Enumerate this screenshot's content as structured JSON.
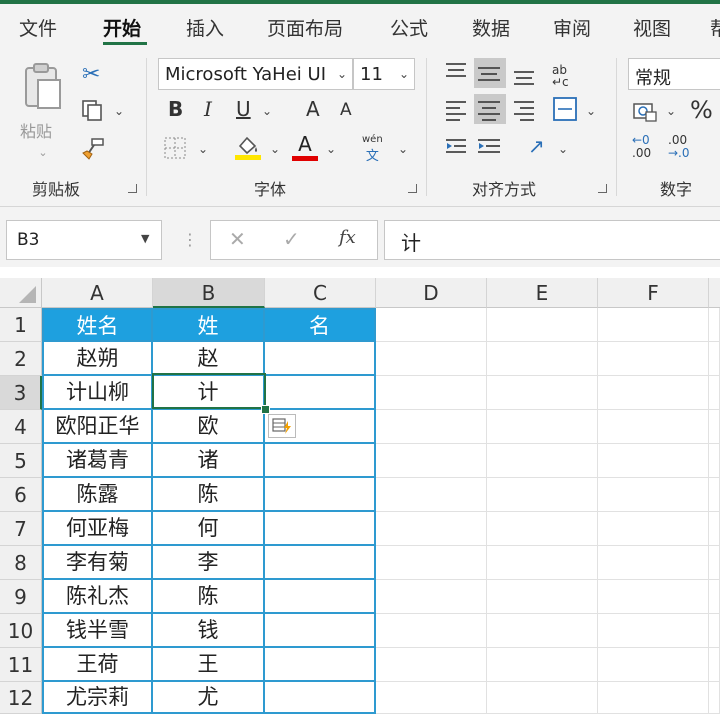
{
  "tabs": [
    "文件",
    "开始",
    "插入",
    "页面布局",
    "公式",
    "数据",
    "审阅",
    "视图",
    "帮"
  ],
  "ribbon": {
    "clipboard": {
      "paste_label": "粘贴",
      "group_label": "剪贴板"
    },
    "font": {
      "font_name": "Microsoft YaHei UI",
      "font_size": "11",
      "bold": "B",
      "italic": "I",
      "underline": "U",
      "grow": "A",
      "shrink": "A",
      "color": "A",
      "phonetic_top": "wén",
      "phonetic_bottom": "文",
      "group_label": "字体",
      "fill_color": "#ffe600",
      "font_color": "#e00000"
    },
    "alignment": {
      "group_label": "对齐方式"
    },
    "number": {
      "format": "常规",
      "percent": "%",
      "comma": ",",
      "inc_decimal_top": "←0",
      "inc_decimal_bottom": ".00",
      "dec_decimal_top": ".00",
      "dec_decimal_bottom": "→.0",
      "group_label": "数字"
    }
  },
  "formula_bar": {
    "name_box": "B3",
    "fx": "fx",
    "content": "计"
  },
  "columns": [
    "A",
    "B",
    "C",
    "D",
    "E",
    "F"
  ],
  "selected_cell": "B3",
  "rows": [
    {
      "n": "1",
      "a": "姓名",
      "b": "姓",
      "c": "名"
    },
    {
      "n": "2",
      "a": "赵朔",
      "b": "赵",
      "c": ""
    },
    {
      "n": "3",
      "a": "计山柳",
      "b": "计",
      "c": ""
    },
    {
      "n": "4",
      "a": "欧阳正华",
      "b": "欧",
      "c": ""
    },
    {
      "n": "5",
      "a": "诸葛青",
      "b": "诸",
      "c": ""
    },
    {
      "n": "6",
      "a": "陈露",
      "b": "陈",
      "c": ""
    },
    {
      "n": "7",
      "a": "何亚梅",
      "b": "何",
      "c": ""
    },
    {
      "n": "8",
      "a": "李有菊",
      "b": "李",
      "c": ""
    },
    {
      "n": "9",
      "a": "陈礼杰",
      "b": "陈",
      "c": ""
    },
    {
      "n": "10",
      "a": "钱半雪",
      "b": "钱",
      "c": ""
    },
    {
      "n": "11",
      "a": "王荷",
      "b": "王",
      "c": ""
    },
    {
      "n": "12",
      "a": "尤宗莉",
      "b": "尤",
      "c": ""
    }
  ],
  "colors": {
    "header_fill": "#1ea0df",
    "table_border": "#2e9ad0",
    "excel_green": "#217346"
  }
}
